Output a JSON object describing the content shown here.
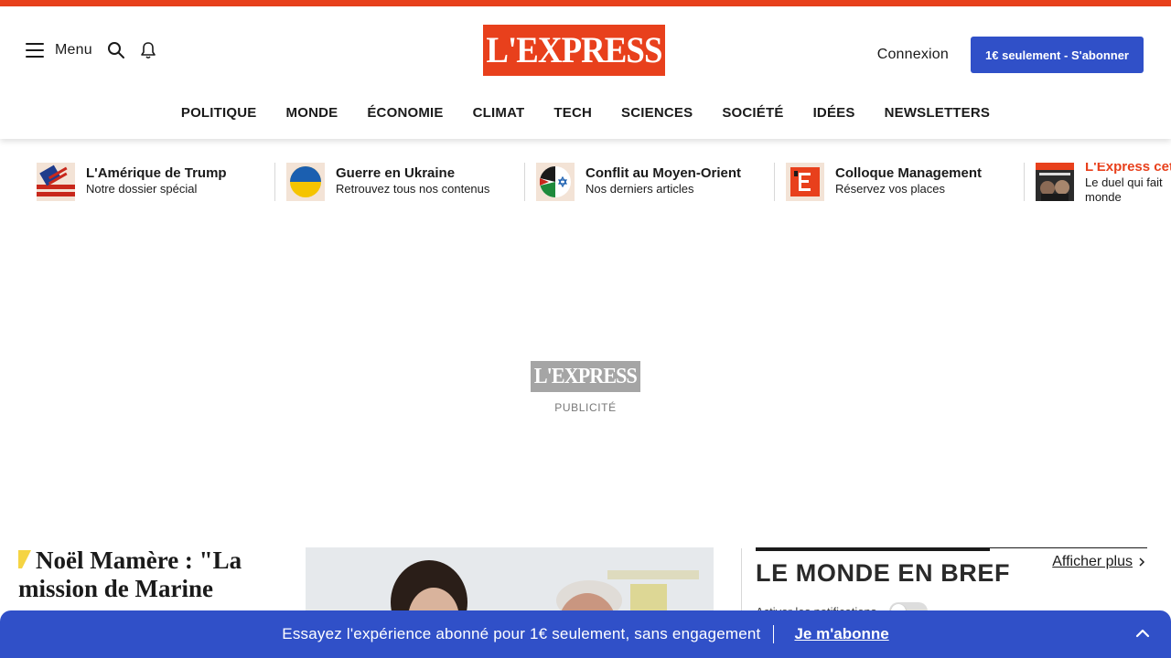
{
  "header": {
    "menu_label": "Menu",
    "logo_text": "L'EXPRESS",
    "login_label": "Connexion",
    "subscribe_label": "1€ seulement - S'abonner"
  },
  "nav": {
    "items": [
      "POLITIQUE",
      "MONDE",
      "ÉCONOMIE",
      "CLIMAT",
      "TECH",
      "SCIENCES",
      "SOCIÉTÉ",
      "IDÉES",
      "NEWSLETTERS"
    ]
  },
  "topics": [
    {
      "title": "L'Amérique de Trump",
      "subtitle": "Notre dossier spécial",
      "icon": "us-flag-icon"
    },
    {
      "title": "Guerre en Ukraine",
      "subtitle": "Retrouvez tous nos contenus",
      "icon": "ukraine-flag-icon"
    },
    {
      "title": "Conflit au Moyen-Orient",
      "subtitle": "Nos derniers articles",
      "icon": "middle-east-flags-icon"
    },
    {
      "title": "Colloque Management",
      "subtitle": "Réservez vos places",
      "icon": "lexpress-e-icon"
    },
    {
      "title": "L'Express cet",
      "subtitle": "Le duel qui fait monde",
      "icon": "magazine-cover-thumb"
    }
  ],
  "ad": {
    "logo_text": "L'EXPRESS",
    "label": "PUBLICITÉ"
  },
  "lead": {
    "title": "Noël Mamère : \"La mission de Marine"
  },
  "brief": {
    "title": "LE MONDE EN BREF",
    "more_label": "Afficher plus",
    "notif_label": "Activer les notifications"
  },
  "promo": {
    "text": "Essayez l'expérience abonné pour 1€ seulement, sans engagement",
    "cta": "Je m'abonne"
  },
  "colors": {
    "brand": "#e8401c",
    "accent_blue": "#3050c8"
  }
}
